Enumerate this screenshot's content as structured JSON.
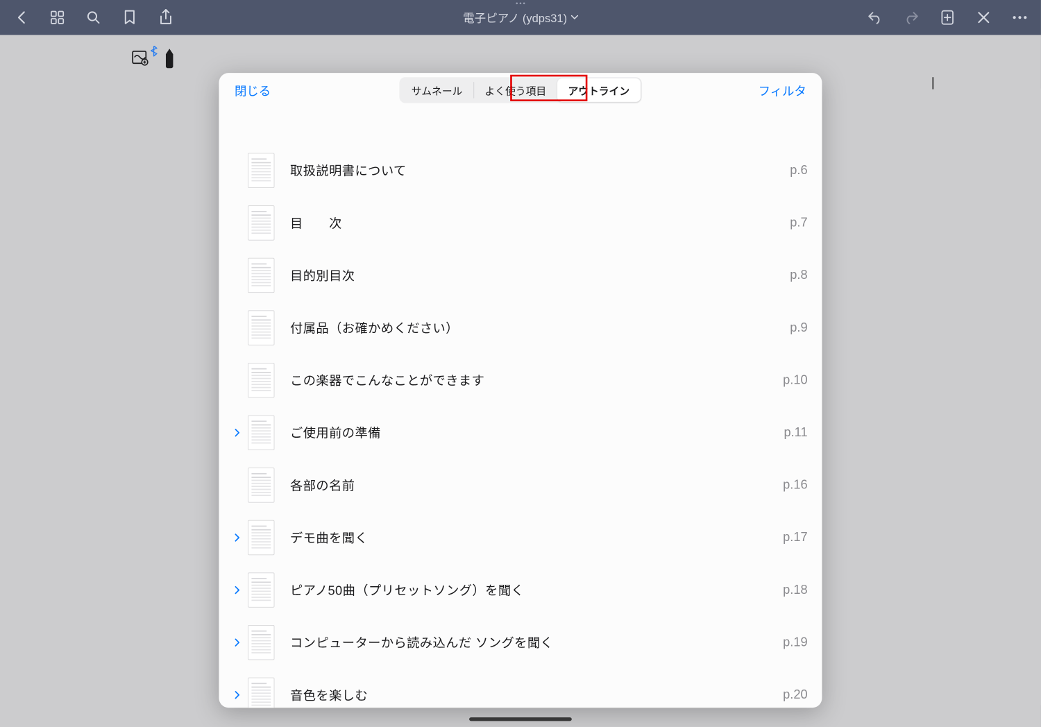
{
  "header": {
    "title": "電子ピアノ (ydps31)"
  },
  "popover": {
    "close": "閉じる",
    "filter": "フィルタ",
    "tabs": {
      "thumbnails": "サムネール",
      "favorites": "よく使う項目",
      "outline": "アウトライン"
    }
  },
  "outline": [
    {
      "title": "取扱説明書について",
      "page": "p.6",
      "expandable": false
    },
    {
      "title": "目　　次",
      "page": "p.7",
      "expandable": false
    },
    {
      "title": "目的別目次",
      "page": "p.8",
      "expandable": false
    },
    {
      "title": "付属品（お確かめください）",
      "page": "p.9",
      "expandable": false
    },
    {
      "title": "この楽器でこんなことができます",
      "page": "p.10",
      "expandable": false
    },
    {
      "title": "ご使用前の準備",
      "page": "p.11",
      "expandable": true
    },
    {
      "title": "各部の名前",
      "page": "p.16",
      "expandable": false
    },
    {
      "title": "デモ曲を聞く",
      "page": "p.17",
      "expandable": true
    },
    {
      "title": "ピアノ50曲（プリセットソング）を聞く",
      "page": "p.18",
      "expandable": true
    },
    {
      "title": "コンピューターから読み込んだ ソングを聞く",
      "page": "p.19",
      "expandable": true
    },
    {
      "title": "音色を楽しむ",
      "page": "p.20",
      "expandable": true
    }
  ]
}
